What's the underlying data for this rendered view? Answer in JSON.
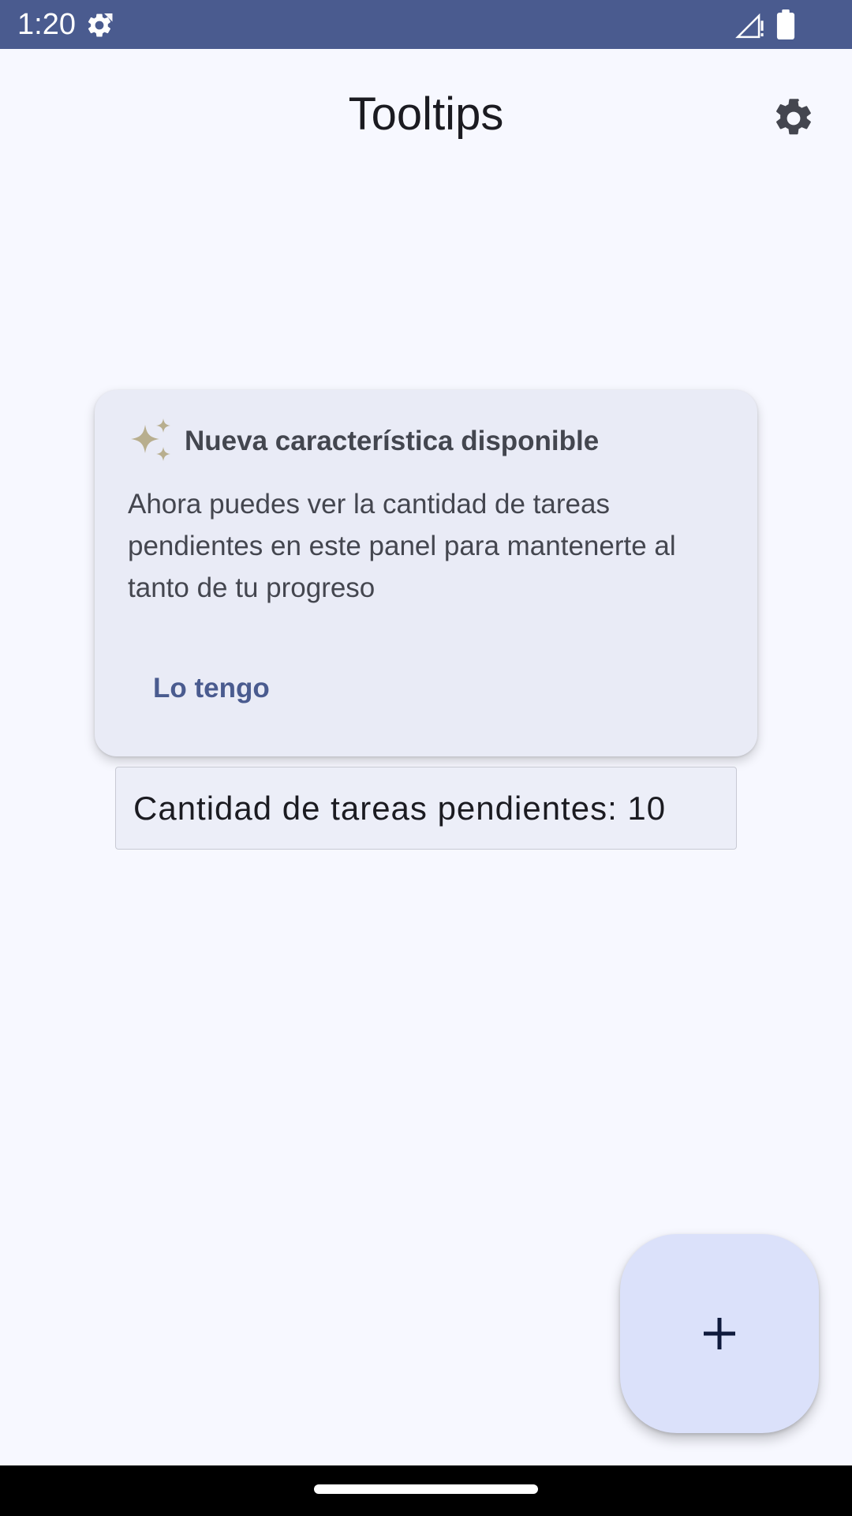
{
  "status_bar": {
    "time": "1:20",
    "icons": [
      "settings-gear-icon",
      "cell-signal-icon",
      "battery-icon"
    ]
  },
  "app_bar": {
    "title": "Tooltips",
    "settings_icon": "gear-icon"
  },
  "tooltip": {
    "icon": "sparkle-icon",
    "title": "Nueva característica disponible",
    "body": "Ahora puedes ver la cantidad de tareas pendientes en este panel para mantenerte al tanto de tu progreso",
    "action_label": "Lo tengo"
  },
  "pending": {
    "text": "Cantidad de tareas pendientes: 10"
  },
  "fab": {
    "icon": "plus-icon"
  },
  "colors": {
    "status_bar": "#4a5b8f",
    "background": "#f7f8ff",
    "card": "#e9ebf6",
    "accent": "#4a5b8f",
    "fab": "#dbe1fa",
    "sparkle": "#b8ae8e"
  }
}
